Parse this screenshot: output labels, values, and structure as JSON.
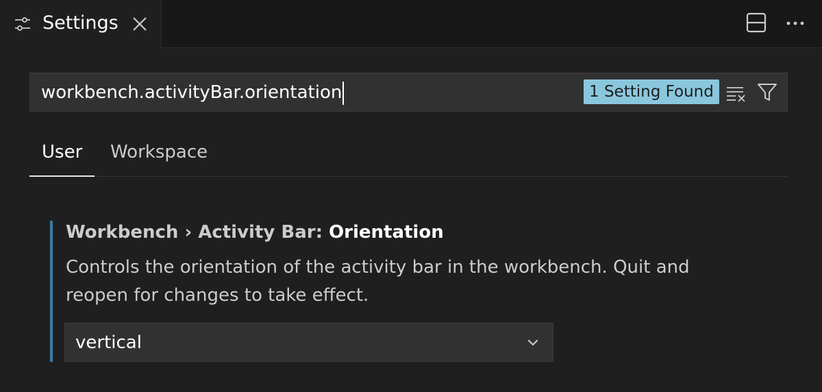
{
  "tab": {
    "icon": "settings-sliders-icon",
    "label": "Settings",
    "close_icon": "close-icon"
  },
  "actions": {
    "split_icon": "split-editor-icon",
    "more_icon": "more-actions-icon"
  },
  "search": {
    "value": "workbench.activityBar.orientation",
    "result_badge": "1 Setting Found",
    "clear_icon": "clear-filter-icon",
    "filter_icon": "filter-icon"
  },
  "scopes": [
    {
      "label": "User",
      "active": true
    },
    {
      "label": "Workspace",
      "active": false
    }
  ],
  "setting": {
    "category": "Workbench › Activity Bar: ",
    "name": "Orientation",
    "description": "Controls the orientation of the activity bar in the workbench. Quit and reopen for changes to take effect.",
    "value": "vertical",
    "chevron_icon": "chevron-down-icon"
  },
  "colors": {
    "background": "#1f1f1f",
    "accent_border": "#3a7ca5",
    "badge": "#8ac7dd"
  }
}
